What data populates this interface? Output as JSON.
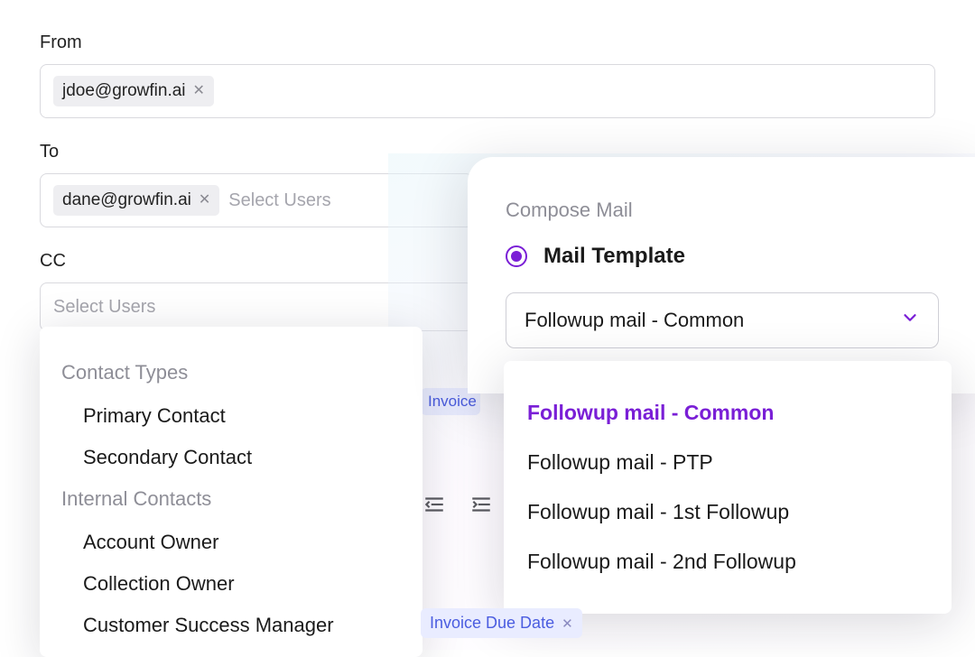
{
  "from": {
    "label": "From",
    "chip": "jdoe@growfin.ai"
  },
  "to": {
    "label": "To",
    "chip": "dane@growfin.ai",
    "placeholder": "Select Users"
  },
  "cc": {
    "label": "CC",
    "placeholder": "Select Users"
  },
  "contactTypes": {
    "section1": "Contact Types",
    "items1": [
      "Primary Contact",
      "Secondary Contact"
    ],
    "section2": "Internal Contacts",
    "items2": [
      "Account Owner",
      "Collection Owner",
      "Customer Success Manager"
    ]
  },
  "bgInvoice": "Invoice",
  "dueChip": "Invoice Due Date",
  "compose": {
    "title": "Compose Mail",
    "radioLabel": "Mail Template",
    "selected": "Followup mail - Common",
    "options": [
      "Followup mail - Common",
      "Followup mail - PTP",
      "Followup mail - 1st Followup",
      "Followup mail - 2nd Followup"
    ]
  }
}
